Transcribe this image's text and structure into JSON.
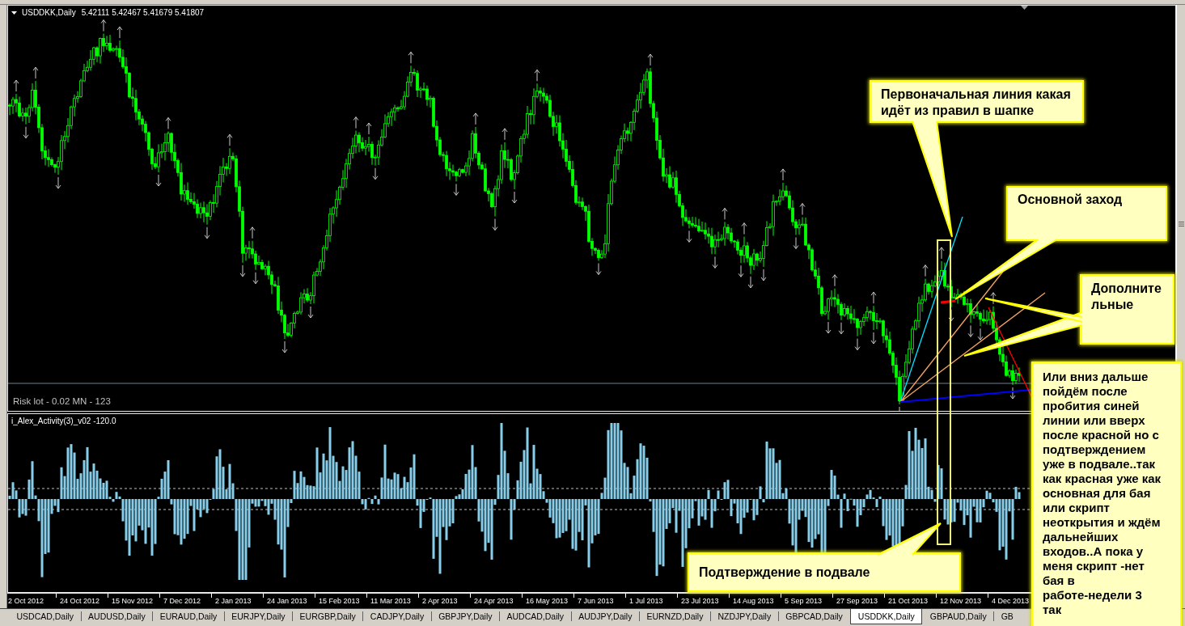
{
  "chart": {
    "symbol": "USDDKK,Daily",
    "ohlc": "5.42111 5.42467 5.41679 5.41807",
    "risk_label": "Risk lot - 0.02 MN - 123"
  },
  "callouts": [
    {
      "text": "Первоначальная линия какая идёт из правил в шапке"
    },
    {
      "text": "Основной заход"
    },
    {
      "text": "Дополнительные"
    },
    {
      "text": "Или вниз дальше пойдём после пробития синей линии или вверх после красной но с подтверждением уже в подвале..так как красная уже как основная для бая или скрипт неоткрытия и ждём дальнейших входов..А пока у меня скрипт -нет бая в работе-недели 3 так"
    },
    {
      "text": "Подтверждение в подвале"
    }
  ],
  "indicator": {
    "label": "i_Alex_Activity(3)_v02 -120.0"
  },
  "time_axis": [
    "2 Oct 2012",
    "24 Oct 2012",
    "15 Nov 2012",
    "7 Dec 2012",
    "2 Jan 2013",
    "24 Jan 2013",
    "15 Feb 2013",
    "11 Mar 2013",
    "2 Apr 2013",
    "24 Apr 2013",
    "16 May 2013",
    "7 Jun 2013",
    "1 Jul 2013",
    "23 Jul 2013",
    "14 Aug 2013",
    "5 Sep 2013",
    "27 Sep 2013",
    "21 Oct 2013",
    "12 Nov 2013",
    "4 Dec 2013"
  ],
  "tabs": [
    {
      "label": "USDCAD,Daily",
      "selected": false
    },
    {
      "label": "AUDUSD,Daily",
      "selected": false
    },
    {
      "label": "EURAUD,Daily",
      "selected": false
    },
    {
      "label": "EURJPY,Daily",
      "selected": false
    },
    {
      "label": "EURGBP,Daily",
      "selected": false
    },
    {
      "label": "CADJPY,Daily",
      "selected": false
    },
    {
      "label": "GBPJPY,Daily",
      "selected": false
    },
    {
      "label": "AUDCAD,Daily",
      "selected": false
    },
    {
      "label": "AUDJPY,Daily",
      "selected": false
    },
    {
      "label": "EURNZD,Daily",
      "selected": false
    },
    {
      "label": "NZDJPY,Daily",
      "selected": false
    },
    {
      "label": "GBPCAD,Daily",
      "selected": false
    },
    {
      "label": "USDDKK,Daily",
      "selected": true
    },
    {
      "label": "GBPAUD,Daily",
      "selected": false
    },
    {
      "label": "GB",
      "selected": false
    }
  ]
}
